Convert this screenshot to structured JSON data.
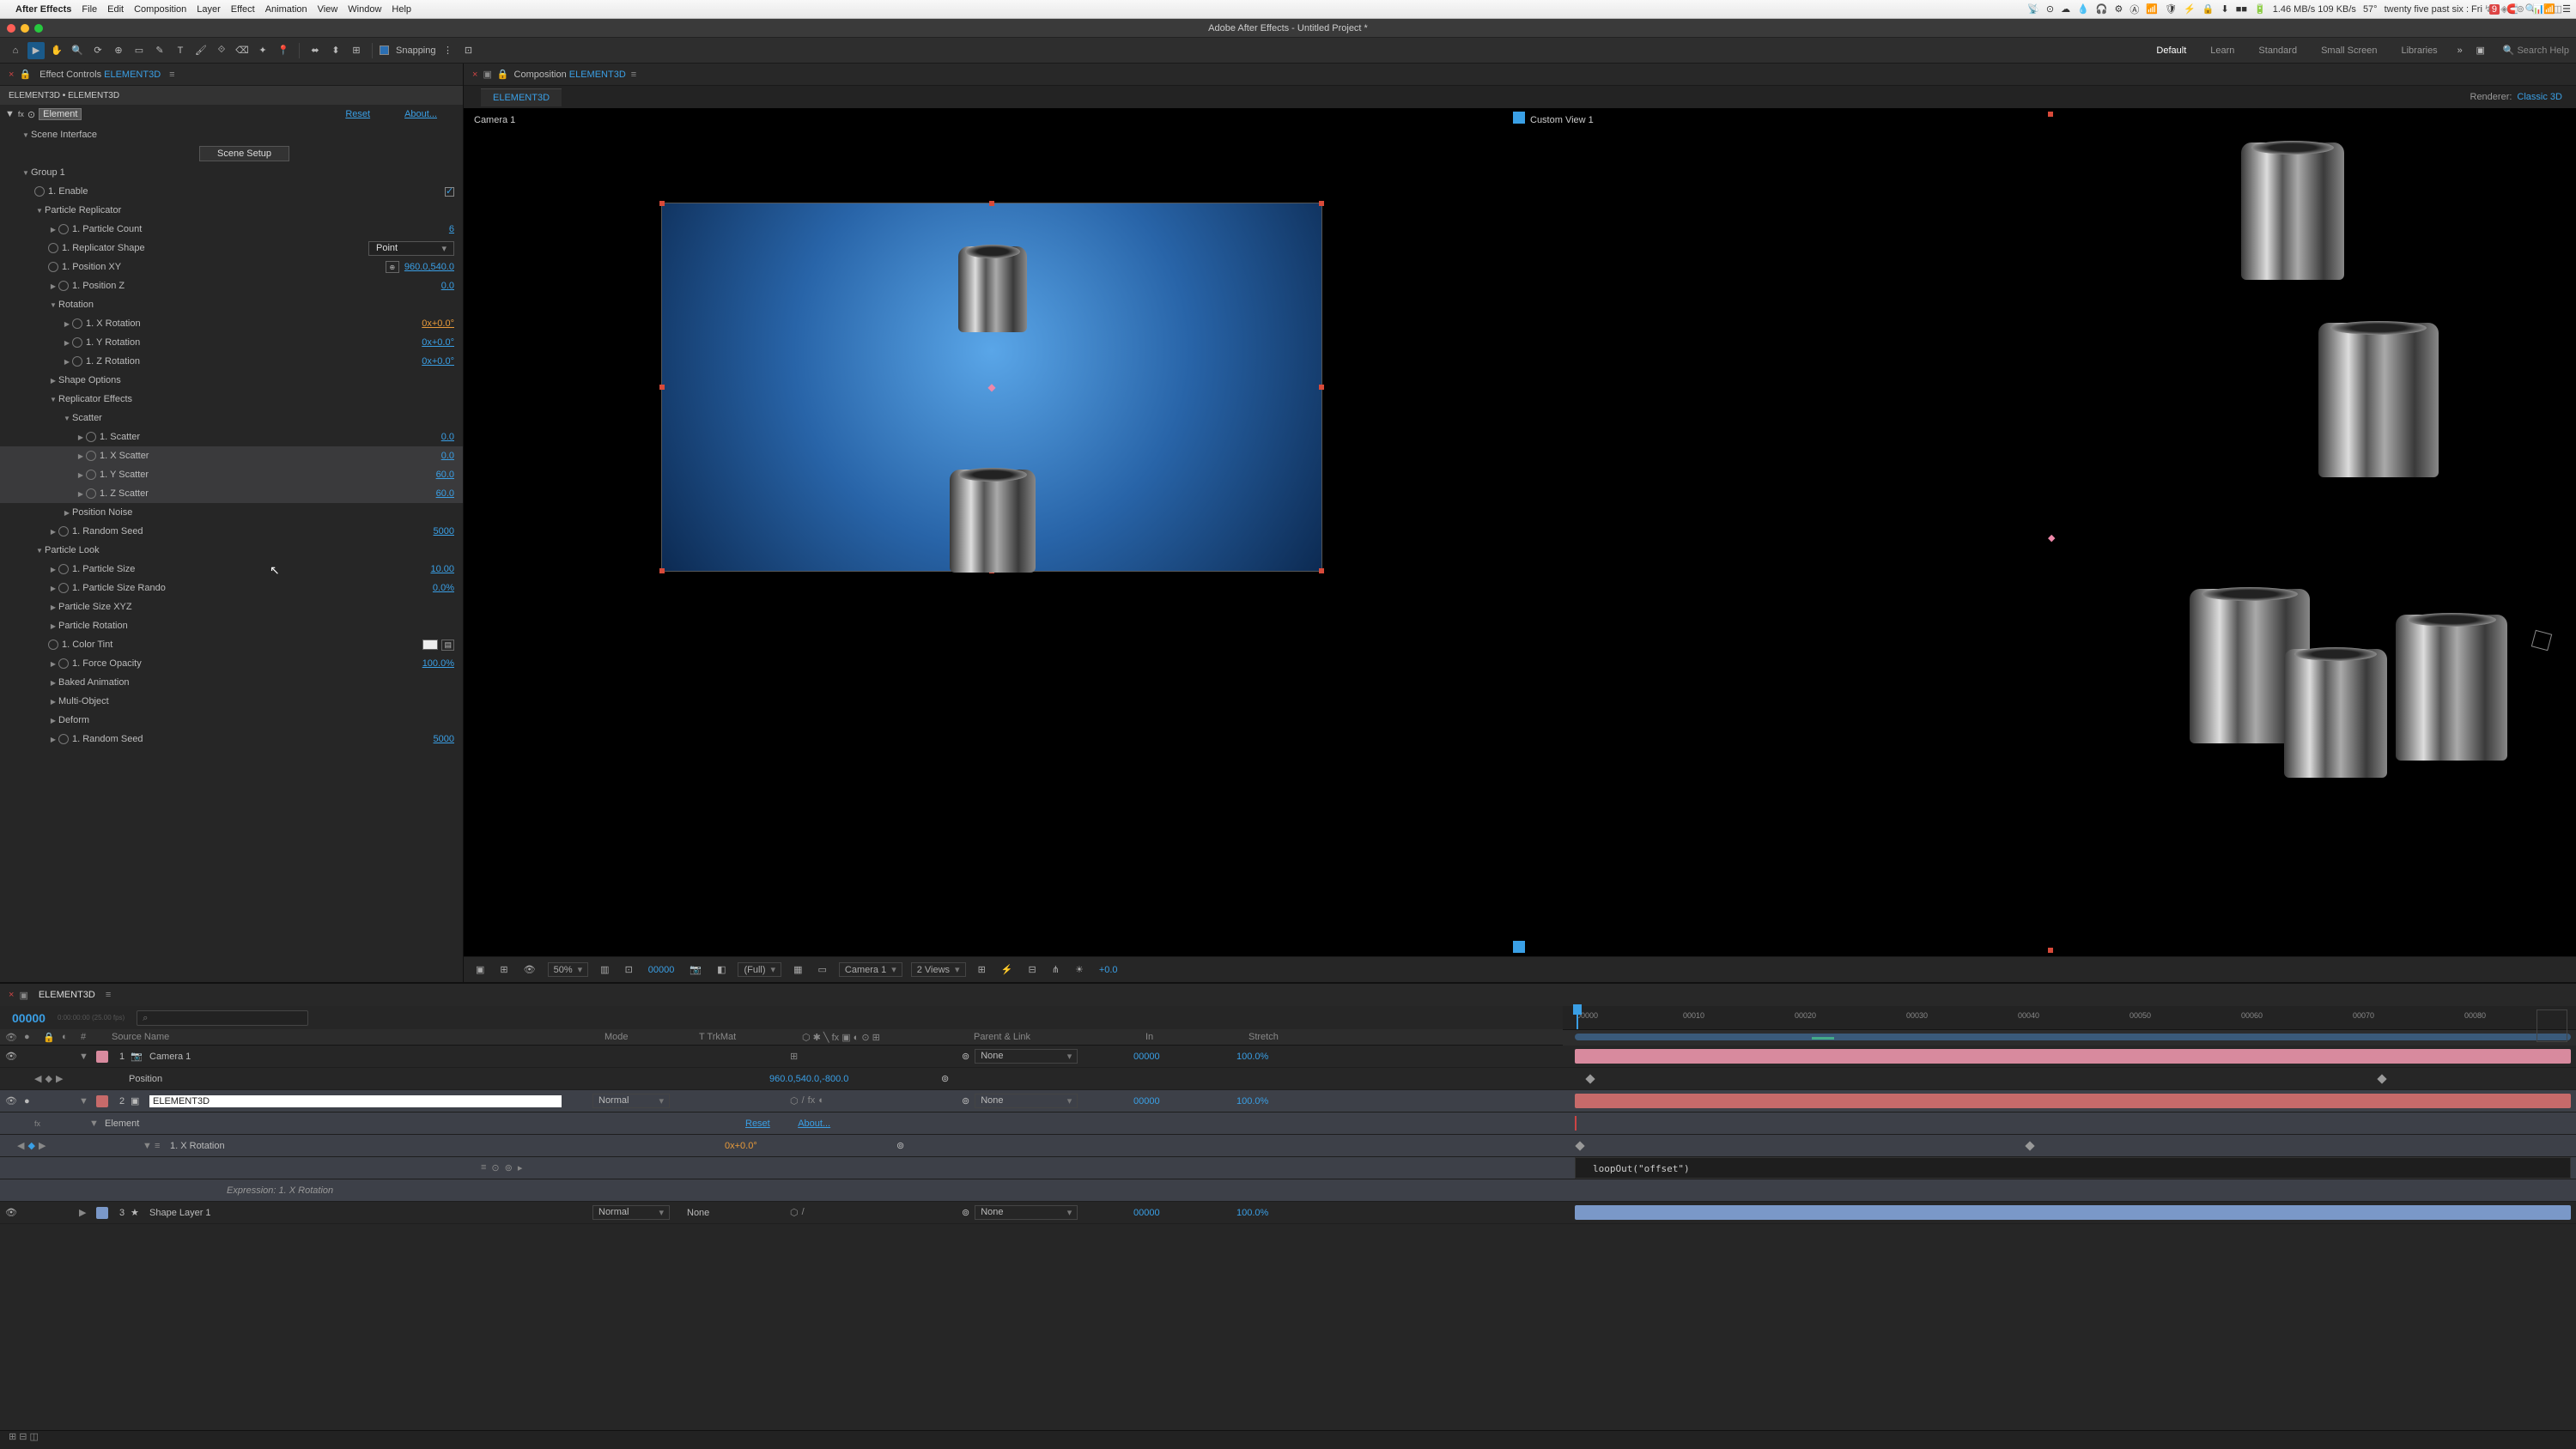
{
  "os": {
    "app_name": "After Effects",
    "menus": [
      "File",
      "Edit",
      "Composition",
      "Layer",
      "Effect",
      "Animation",
      "View",
      "Window",
      "Help"
    ],
    "right": {
      "net": "1.46 MB/s 109 KB/s",
      "temp": "57°",
      "clock": "twenty five past six : Fri",
      "date": "9"
    }
  },
  "window_title": "Adobe After Effects - Untitled Project *",
  "toolbar": {
    "snapping_label": "Snapping",
    "workspaces": [
      "Default",
      "Learn",
      "Standard",
      "Small Screen",
      "Libraries"
    ],
    "active_workspace": "Default",
    "search_placeholder": "Search Help"
  },
  "effects_panel": {
    "tab_prefix": "Effect Controls ",
    "tab_layer": "ELEMENT3D",
    "sub_header": "ELEMENT3D • ELEMENT3D",
    "effect_name": "Element",
    "reset": "Reset",
    "about": "About...",
    "scene_interface": "Scene Interface",
    "scene_setup_btn": "Scene Setup",
    "group1": "Group 1",
    "enable": "1. Enable",
    "particle_replicator": "Particle Replicator",
    "particle_count_label": "1. Particle Count",
    "particle_count_val": "6",
    "replicator_shape_label": "1. Replicator Shape",
    "replicator_shape_val": "Point",
    "position_xy_label": "1. Position XY",
    "position_xy_val": "960.0,540.0",
    "position_z_label": "1. Position Z",
    "position_z_val": "0.0",
    "rotation": "Rotation",
    "x_rot_label": "1. X Rotation",
    "x_rot_val": "0x+0.0°",
    "y_rot_label": "1. Y Rotation",
    "y_rot_val": "0x+0.0°",
    "z_rot_label": "1. Z Rotation",
    "z_rot_val": "0x+0.0°",
    "shape_options": "Shape Options",
    "replicator_effects": "Replicator Effects",
    "scatter": "Scatter",
    "scatter_label": "1. Scatter",
    "scatter_val": "0.0",
    "x_scatter_label": "1. X Scatter",
    "x_scatter_val": "0.0",
    "y_scatter_label": "1. Y Scatter",
    "y_scatter_val": "60.0",
    "z_scatter_label": "1. Z Scatter",
    "z_scatter_val": "60.0",
    "position_noise": "Position Noise",
    "random_seed_label": "1. Random Seed",
    "random_seed_val": "5000",
    "particle_look": "Particle Look",
    "particle_size_label": "1. Particle Size",
    "particle_size_val": "10.00",
    "particle_size_rand_label": "1. Particle Size Rando",
    "particle_size_rand_val": "0.0%",
    "particle_size_xyz": "Particle Size XYZ",
    "particle_rotation": "Particle Rotation",
    "color_tint_label": "1. Color Tint",
    "force_opacity_label": "1. Force Opacity",
    "force_opacity_val": "100.0%",
    "baked_animation": "Baked Animation",
    "multi_object": "Multi-Object",
    "deform": "Deform",
    "random_seed2_label": "1. Random Seed",
    "random_seed2_val": "5000"
  },
  "viewer": {
    "comp_prefix": "Composition ",
    "comp_name": "ELEMENT3D",
    "renderer_label": "Renderer:",
    "renderer_val": "Classic 3D",
    "subtab": "ELEMENT3D",
    "view1_label": "Camera 1",
    "view2_label": "Custom View 1",
    "footer": {
      "zoom": "50%",
      "timecode": "00000",
      "res": "(Full)",
      "active_cam": "Camera 1",
      "views": "2 Views",
      "exposure": "+0.0"
    }
  },
  "timeline": {
    "tab": "ELEMENT3D",
    "current_time": "00000",
    "fps_note": "0:00:00:00 (25.00 fps)",
    "search_placeholder": "⌕",
    "cols": {
      "num": "#",
      "name": "Source Name",
      "mode": "Mode",
      "trk": "T  TrkMat",
      "parent": "Parent & Link",
      "in": "In",
      "stretch": "Stretch"
    },
    "ruler": [
      "00000",
      "00010",
      "00020",
      "00030",
      "00040",
      "00050",
      "00060",
      "00070",
      "00080"
    ],
    "layers": [
      {
        "num": "1",
        "name": "Camera 1",
        "color": "#d88a9e",
        "mode": "",
        "trk": "",
        "parent": "None",
        "in": "00000",
        "stretch": "100.0%",
        "bar": "pink",
        "icon": "📷"
      },
      {
        "sub": true,
        "name": "Position",
        "val": "960.0,540.0,-800.0"
      },
      {
        "num": "2",
        "name": "ELEMENT3D",
        "color": "#c76a6a",
        "mode": "Normal",
        "trk": "",
        "parent": "None",
        "in": "00000",
        "stretch": "100.0%",
        "bar": "red",
        "icon": "▣",
        "selected": true,
        "editing": true
      },
      {
        "sub": true,
        "name": "Element",
        "reset": "Reset",
        "about": "About..."
      },
      {
        "sub2": true,
        "name": "1. X Rotation",
        "val": "0x+0.0°"
      },
      {
        "sub3": true,
        "name": "Expression: 1. X Rotation",
        "expr": "loopOut(\"offset\")"
      },
      {
        "num": "3",
        "name": "Shape Layer 1",
        "color": "#7a98c8",
        "mode": "Normal",
        "trk": "None",
        "parent": "None",
        "in": "00000",
        "stretch": "100.0%",
        "bar": "blue",
        "icon": "★"
      }
    ]
  }
}
